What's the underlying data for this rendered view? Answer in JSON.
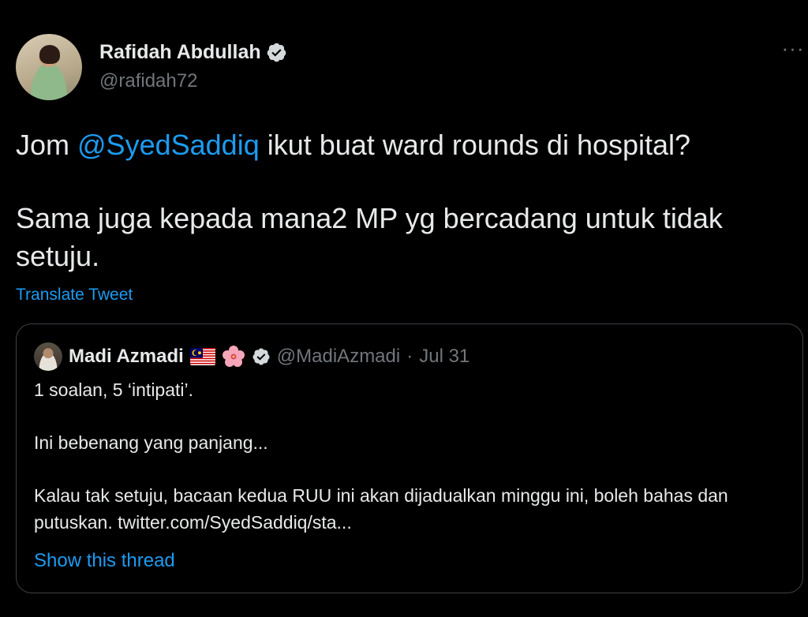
{
  "author": {
    "name": "Rafidah Abdullah",
    "handle": "@rafidah72",
    "verified": true
  },
  "icons": {
    "verified": "verified-badge-icon",
    "more": "more-options-icon",
    "flag": "malaysia-flag-icon",
    "flower": "hibiscus-icon"
  },
  "tweet": {
    "line1_before": "Jom ",
    "mention": "@SyedSaddiq",
    "line1_after": " ikut buat ward rounds di hospital?",
    "paragraph2": "Sama juga kepada mana2 MP yg bercadang untuk tidak setuju."
  },
  "translate_label": "Translate Tweet",
  "quote": {
    "name": "Madi Azmadi",
    "handle": "@MadiAzmadi",
    "separator": "·",
    "date": "Jul 31",
    "line1": "1 soalan, 5 ‘intipati’.",
    "line2": "Ini bebenang yang panjang...",
    "line3": "Kalau tak setuju, bacaan kedua RUU ini akan dijadualkan minggu ini, boleh bahas dan putuskan. twitter.com/SyedSaddiq/sta...",
    "show_thread_label": "Show this thread"
  },
  "colors": {
    "background": "#000000",
    "text": "#e7e9ea",
    "muted": "#71767b",
    "link": "#1d9bf0",
    "border": "#3e4144"
  }
}
